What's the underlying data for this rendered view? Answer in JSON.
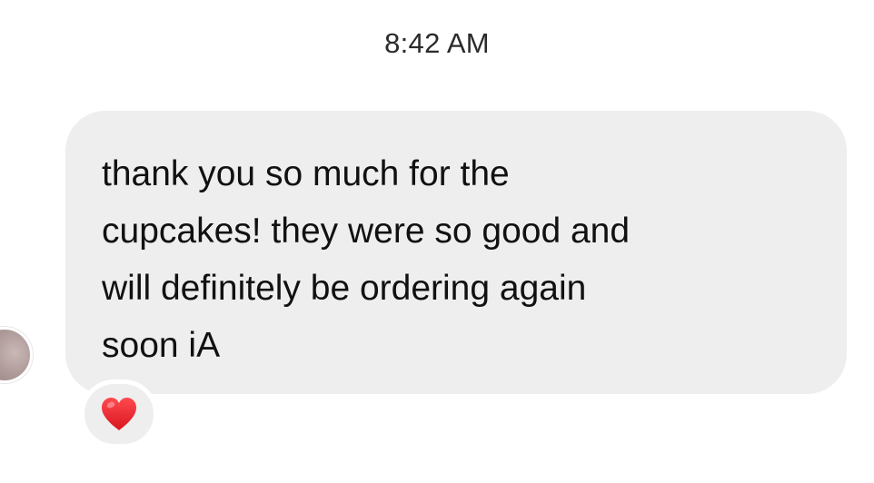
{
  "timestamp": "8:42 AM",
  "message": {
    "text": "thank you so much for the\ncupcakes! they were so good and\nwill definitely be ordering again\nsoon iA",
    "reaction_icon": "red-heart-icon",
    "reaction_color": "#e8202a"
  },
  "colors": {
    "bubble": "#eeeeef",
    "text": "#111111",
    "timestamp": "#2b2b2b"
  }
}
